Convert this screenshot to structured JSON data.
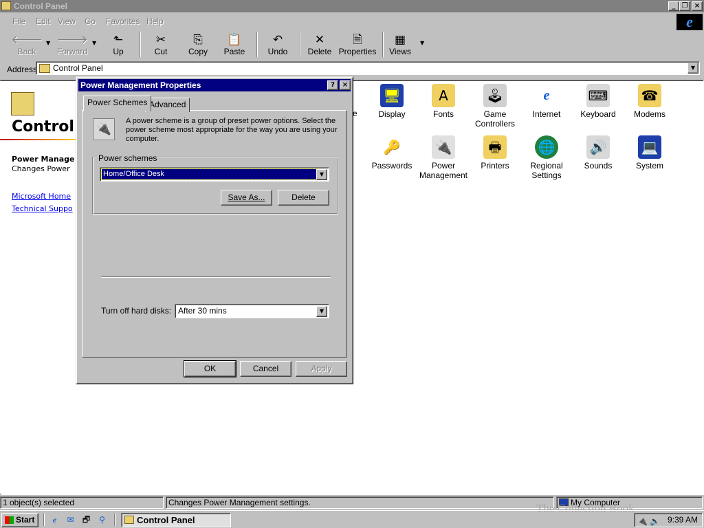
{
  "window": {
    "title": "Control Panel"
  },
  "menu": [
    "File",
    "Edit",
    "View",
    "Go",
    "Favorites",
    "Help"
  ],
  "toolbar": {
    "back": "Back",
    "forward": "Forward",
    "up": "Up",
    "cut": "Cut",
    "copy": "Copy",
    "paste": "Paste",
    "undo": "Undo",
    "delete": "Delete",
    "properties": "Properties",
    "views": "Views"
  },
  "address": {
    "label": "Address",
    "value": "Control Panel"
  },
  "left_pane": {
    "title": "Control",
    "item_title": "Power Manage",
    "item_desc": "Changes Power",
    "links": [
      "Microsoft Home",
      "Technical Suppo"
    ]
  },
  "partial_label": "e",
  "icons": [
    {
      "label": "Display",
      "icon": "display-icon"
    },
    {
      "label": "Fonts",
      "icon": "fonts-icon"
    },
    {
      "label": "Game Controllers",
      "icon": "game-controllers-icon"
    },
    {
      "label": "Internet",
      "icon": "internet-icon"
    },
    {
      "label": "Keyboard",
      "icon": "keyboard-icon"
    },
    {
      "label": "Modems",
      "icon": "modems-icon"
    },
    {
      "label": "Passwords",
      "icon": "passwords-icon"
    },
    {
      "label": "Power Management",
      "icon": "power-management-icon"
    },
    {
      "label": "Printers",
      "icon": "printers-icon"
    },
    {
      "label": "Regional Settings",
      "icon": "regional-settings-icon"
    },
    {
      "label": "Sounds",
      "icon": "sounds-icon"
    },
    {
      "label": "System",
      "icon": "system-icon"
    }
  ],
  "dialog": {
    "title": "Power Management Properties",
    "help_button": "?",
    "close_button": "×",
    "tabs": [
      "Power Schemes",
      "Advanced"
    ],
    "description": "A power scheme is a group of preset power options. Select the power scheme most appropriate for the way you are using your computer.",
    "group_label": "Power schemes",
    "selected_scheme": "Home/Office Desk",
    "save_as": "Save As...",
    "delete": "Delete",
    "hard_disk_label": "Turn off hard disks:",
    "hard_disk_value": "After 30 mins",
    "ok": "OK",
    "cancel": "Cancel",
    "apply": "Apply"
  },
  "status": {
    "selected": "1 object(s) selected",
    "message": "Changes Power Management settings.",
    "zone": "My Computer"
  },
  "taskbar": {
    "start": "Start",
    "active_window": "Control Panel",
    "clock": "9:39 AM"
  },
  "watermark": "The Collection Book"
}
